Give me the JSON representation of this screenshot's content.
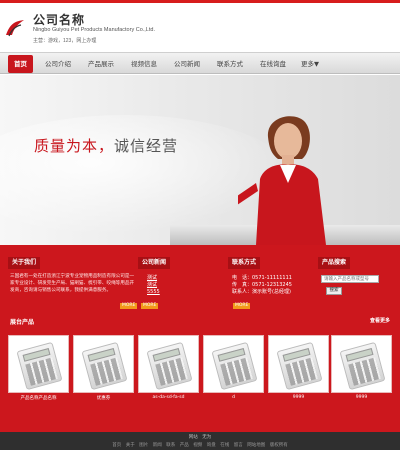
{
  "header": {
    "company_name": "公司名称",
    "company_en": "Ningbo Guiyou Pet Products Manufactory Co.,Ltd.",
    "note": "主营：游戏，123，网上办理"
  },
  "nav": {
    "items": [
      "首页",
      "公司介绍",
      "产品展示",
      "视频信息",
      "公司新闻",
      "联系方式",
      "在线询盘",
      "更多▼"
    ]
  },
  "banner": {
    "slogan_part1": "质量为本，",
    "slogan_part2": "诚信经营"
  },
  "about": {
    "title": "关于我们",
    "text": "三国君有一处在打造浙江宁波专业宠物用品制造有限公司是一家专业设计、研发完生产局、猫刷猫、梳引带、咬绳等用品开发商，咨询请与销售公司联系，我提供满意服务。",
    "more": "MORE"
  },
  "news": {
    "title": "公司新闻",
    "items": [
      "测试",
      "测试",
      "5555"
    ],
    "more": "MORE"
  },
  "contact": {
    "title": "联系方式",
    "items": [
      "电　话：0571-11111111",
      "传　真：0571-12313245",
      "联系人：演示账号(总经理)"
    ],
    "more": "MORE"
  },
  "search": {
    "title": "产品搜索",
    "placeholder": "请输入产品名称或型号",
    "button_label": "搜索"
  },
  "products": {
    "title": "展台产品",
    "more": "查看更多",
    "items": [
      {
        "caption": "产品名称产品名称"
      },
      {
        "caption": "优惠券"
      },
      {
        "caption": "as-da-sd-fa-sd"
      },
      {
        "caption": "d"
      },
      {
        "caption": "9999"
      },
      {
        "caption": "9999"
      }
    ]
  },
  "footer": {
    "line1": "网站　无为",
    "line2": "首页　关于　图片　新闻　联系　产品　视频　询盘　在线　留言　网站地图　版权所有"
  },
  "colors": {
    "brand_red": "#cc171d",
    "dark_red": "#a80f14",
    "badge_orange": "#f29a1b",
    "footer_bg": "#2f2f2f"
  }
}
